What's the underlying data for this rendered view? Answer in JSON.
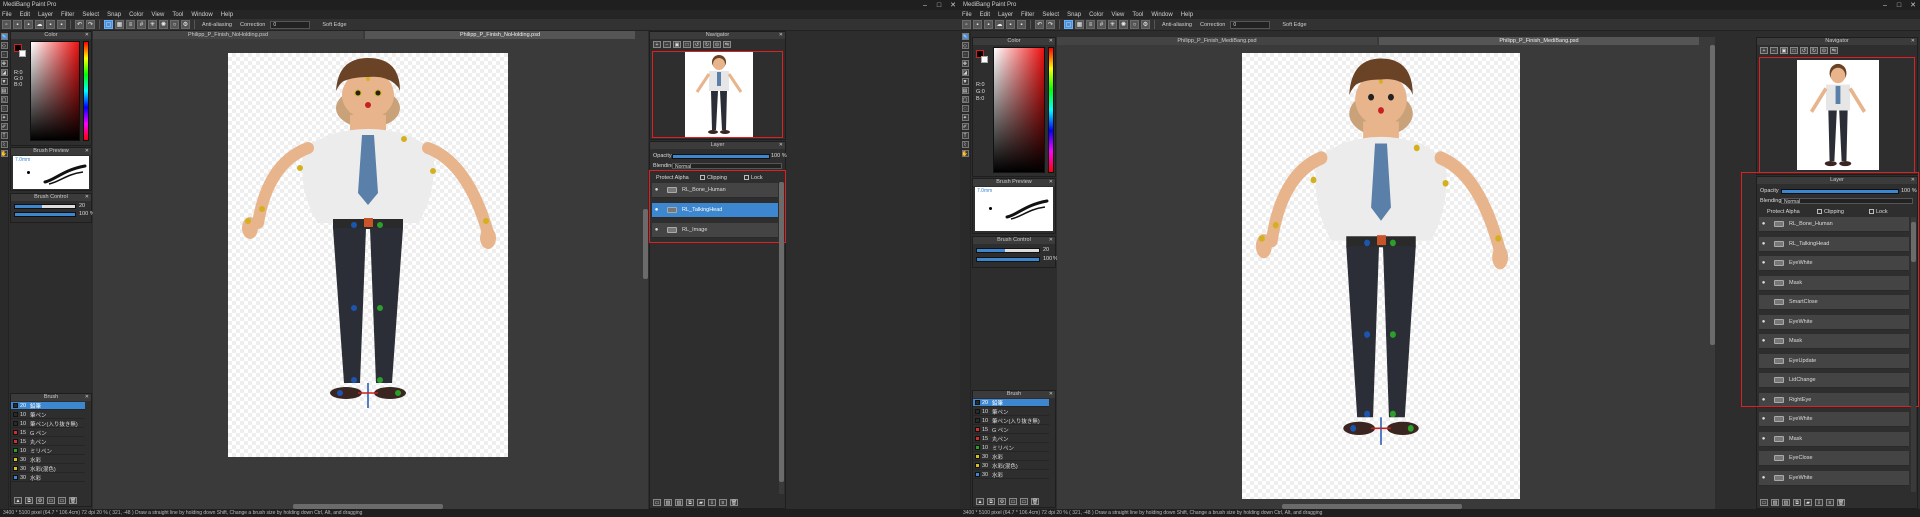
{
  "app_title": "MediBang Paint Pro",
  "menu": [
    "File",
    "Edit",
    "Layer",
    "Filter",
    "Select",
    "Snap",
    "Color",
    "View",
    "Tool",
    "Window",
    "Help"
  ],
  "toolbar_left": {
    "antialias": "Anti-aliasing",
    "correction": "Correction",
    "correction_value": "0",
    "soft_edge": "Soft Edge"
  },
  "toolbar_right": {
    "antialias": "Anti-aliasing",
    "correction": "Correction",
    "correction_value": "0",
    "soft_edge": "Soft Edge"
  },
  "panels": {
    "color": "Color",
    "brush_preview": "Brush Preview",
    "brush_control": "Brush Control",
    "brush": "Brush",
    "navigator": "Navigator",
    "layer": "Layer"
  },
  "color_values": {
    "r": "R:0",
    "g": "G:0",
    "b": "B:0"
  },
  "brush_preview_text": "7.0mm",
  "brush_control": {
    "size": "20",
    "opacity": "100",
    "pct": "%"
  },
  "brush_left": [
    {
      "size": "20",
      "name": "鉛筆",
      "color": "#2a2a2a"
    },
    {
      "size": "10",
      "name": "筆ペン",
      "color": "#2a2a2a"
    },
    {
      "size": "10",
      "name": "筆ペン(入り抜き無)",
      "color": "#2a2a2a"
    },
    {
      "size": "15",
      "name": "G ペン",
      "color": "#d03030"
    },
    {
      "size": "15",
      "name": "丸ペン",
      "color": "#d03030"
    },
    {
      "size": "10",
      "name": "ミリペン",
      "color": "#2aa02a"
    },
    {
      "size": "30",
      "name": "水彩",
      "color": "#d0c020"
    },
    {
      "size": "30",
      "name": "水彩(混色)",
      "color": "#d0c020"
    },
    {
      "size": "30",
      "name": "水彩",
      "color": "#3d86d0"
    }
  ],
  "brush_right": [
    {
      "size": "20",
      "name": "鉛筆",
      "color": "#2a2a2a"
    },
    {
      "size": "10",
      "name": "筆ペン",
      "color": "#2a2a2a"
    },
    {
      "size": "10",
      "name": "筆ペン(入り抜き無)",
      "color": "#2a2a2a"
    },
    {
      "size": "15",
      "name": "G ペン",
      "color": "#d03030"
    },
    {
      "size": "15",
      "name": "丸ペン",
      "color": "#d03030"
    },
    {
      "size": "10",
      "name": "ミリペン",
      "color": "#2aa02a"
    },
    {
      "size": "30",
      "name": "水彩",
      "color": "#d0c020"
    },
    {
      "size": "30",
      "name": "水彩(混色)",
      "color": "#d0c020"
    },
    {
      "size": "30",
      "name": "水彩",
      "color": "#3d86d0"
    }
  ],
  "left_tabs": [
    "Philipp_P_Finish_NoHolding.psd",
    "Philipp_P_Finish_NoHolding.psd"
  ],
  "right_tabs": [
    "Philipp_P_Finish_MediBang.psd",
    "Philipp_P_Finish_MediBang.psd"
  ],
  "layer_left": {
    "opacity_label": "Opacity",
    "opacity_value": "100 %",
    "blending_label": "Blending",
    "blending_value": "Normal",
    "protect_alpha": "Protect Alpha",
    "clipping": "Clipping",
    "lock": "Lock",
    "items": [
      {
        "name": "RL_Bone_Human",
        "selected": false
      },
      {
        "name": "RL_TalkingHead",
        "selected": true
      },
      {
        "name": "RL_Image",
        "selected": false
      }
    ]
  },
  "layer_right": {
    "opacity_label": "Opacity",
    "opacity_value": "100 %",
    "blending_label": "Blending",
    "blending_value": "Normal",
    "protect_alpha": "Protect Alpha",
    "clipping": "Clipping",
    "lock": "Lock",
    "items": [
      {
        "name": "RL_Bone_Human",
        "eye": true
      },
      {
        "name": "RL_TalkingHead",
        "eye": true
      },
      {
        "name": "EyeWhite",
        "eye": true
      },
      {
        "name": "Mask",
        "eye": true
      },
      {
        "name": "SmartClose",
        "eye": false
      },
      {
        "name": "EyeWhite",
        "eye": true
      },
      {
        "name": "Mask",
        "eye": true
      },
      {
        "name": "EyeUpdate",
        "eye": false
      },
      {
        "name": "LidChange",
        "eye": false
      },
      {
        "name": "RightEye",
        "eye": true
      },
      {
        "name": "EyeWhite",
        "eye": true
      },
      {
        "name": "Mask",
        "eye": true
      },
      {
        "name": "EyeClose",
        "eye": false
      },
      {
        "name": "EyeWhite",
        "eye": true
      }
    ]
  },
  "status_left": "3400 * 5100 pixel   (64.7 * 106.4cm)   72 dpi   20 %   ( 321, -48 )   Draw a straight line by holding down Shift, Change a brush size by holding down Ctrl, Alt, and dragging",
  "status_right": "3400 * 5100 pixel   (64.7 * 106.4cm)   72 dpi   20 %   ( 321, -48 )   Draw a straight line by holding down Shift, Change a brush size by holding down Ctrl, Alt, and dragging",
  "colors": {
    "accent": "#3d86d0",
    "highlight": "#e02020"
  }
}
